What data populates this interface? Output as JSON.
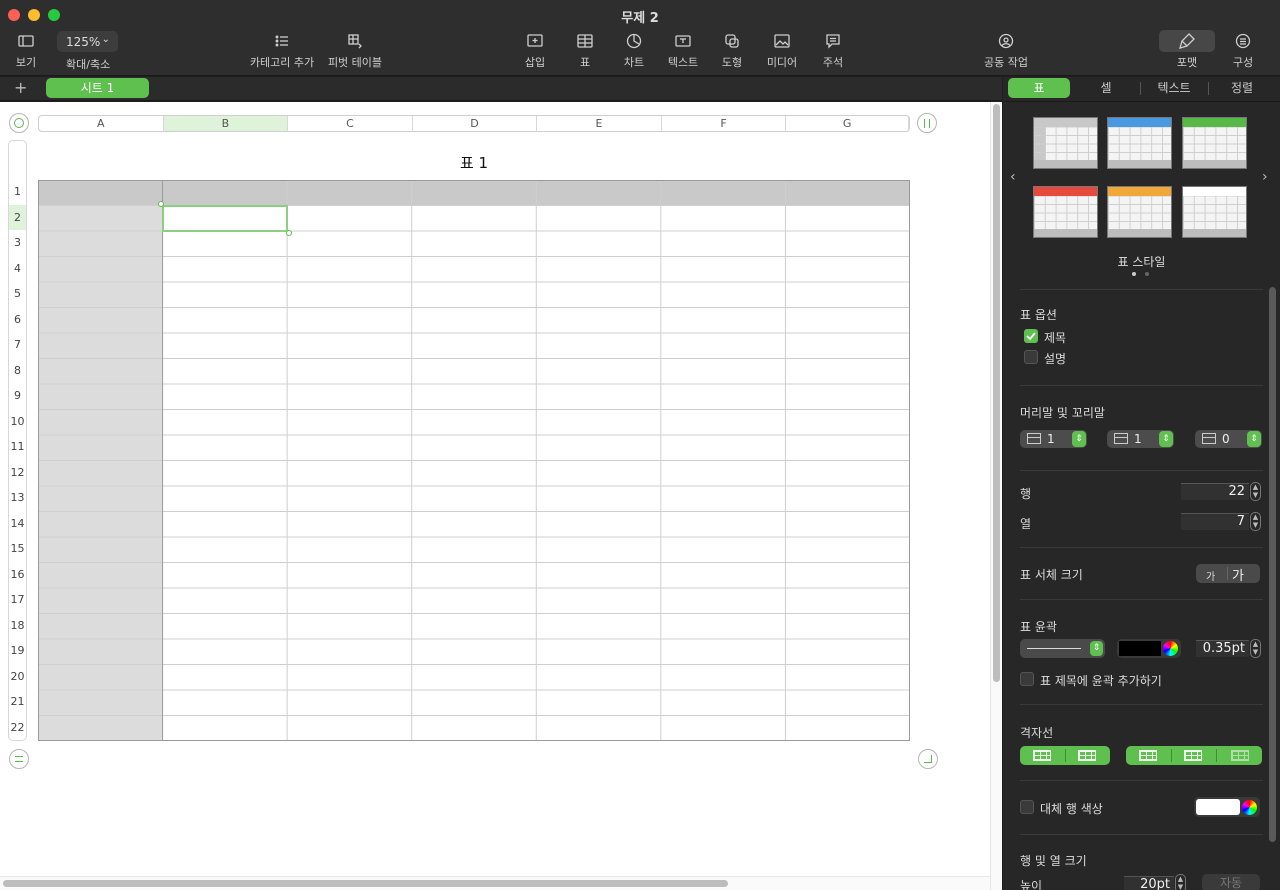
{
  "window": {
    "title": "무제 2"
  },
  "toolbar": {
    "view_label": "보기",
    "zoom_value": "125%",
    "zoom_label": "확대/축소",
    "category_label": "카테고리 추가",
    "pivot_label": "피벗 테이블",
    "insert_label": "삽입",
    "table_label": "표",
    "chart_label": "차트",
    "text_label": "텍스트",
    "shape_label": "도형",
    "media_label": "미디어",
    "comment_label": "주석",
    "collab_label": "공동 작업",
    "format_label": "포맷",
    "organize_label": "구성"
  },
  "sheets": {
    "add": "+",
    "active_tab": "시트 1"
  },
  "table": {
    "title": "표 1",
    "columns": [
      "A",
      "B",
      "C",
      "D",
      "E",
      "F",
      "G"
    ],
    "selected_column": "B",
    "rows": [
      "1",
      "2",
      "3",
      "4",
      "5",
      "6",
      "7",
      "8",
      "9",
      "10",
      "11",
      "12",
      "13",
      "14",
      "15",
      "16",
      "17",
      "18",
      "19",
      "20",
      "21",
      "22"
    ],
    "selected_row": "2"
  },
  "panel": {
    "tabs": [
      "표",
      "셀",
      "텍스트",
      "정렬"
    ],
    "active_tab": "표",
    "style_label": "표 스타일",
    "style_colors": [
      "#c8c8c8",
      "#4a98e0",
      "#58b947",
      "#e54a3c",
      "#f0a838",
      "#ffffff"
    ],
    "options_title": "표 옵션",
    "opt_title_label": "제목",
    "opt_caption_label": "설명",
    "opt_title_checked": true,
    "opt_caption_checked": false,
    "headers_title": "머리말 및 꼬리말",
    "header_rows": "1",
    "header_cols": "1",
    "footer_rows": "0",
    "rows_label": "행",
    "rows_value": "22",
    "cols_label": "열",
    "cols_value": "7",
    "font_size_label": "표 서체 크기",
    "font_small": "가",
    "font_large": "가",
    "outline_title": "표 윤곽",
    "outline_width": "0.35pt",
    "outline_color": "#000000",
    "outline_title_checkbox": "표 제목에 윤곽 추가하기",
    "gridlines_title": "격자선",
    "alt_row_label": "대체 행 색상",
    "alt_row_color": "#ffffff",
    "row_col_size_title": "행 및 열 크기",
    "height_label": "높이",
    "height_value": "20pt",
    "auto_label": "자동"
  }
}
